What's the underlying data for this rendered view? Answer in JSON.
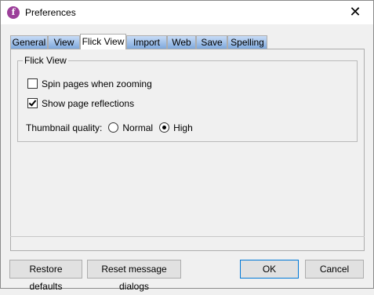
{
  "window": {
    "title": "Preferences",
    "close_glyph": "✕",
    "app_icon_glyph": "f"
  },
  "tabs": [
    {
      "label": "General",
      "active": false
    },
    {
      "label": "View",
      "active": false
    },
    {
      "label": "Flick View",
      "active": true
    },
    {
      "label": "Import",
      "active": false
    },
    {
      "label": "Web",
      "active": false
    },
    {
      "label": "Save",
      "active": false
    },
    {
      "label": "Spelling",
      "active": false
    }
  ],
  "flick_view": {
    "group_label": "Flick View",
    "spin_pages": {
      "label": "Spin pages when zooming",
      "checked": false
    },
    "show_reflections": {
      "label": "Show page reflections",
      "checked": true
    },
    "thumbnail_quality": {
      "label": "Thumbnail quality:",
      "options": [
        {
          "label": "Normal",
          "selected": false
        },
        {
          "label": "High",
          "selected": true
        }
      ]
    }
  },
  "buttons": {
    "restore_defaults": "Restore defaults",
    "reset_dialogs": "Reset message dialogs",
    "ok": "OK",
    "cancel": "Cancel"
  },
  "icons": {
    "app": "app-logo-icon",
    "close": "close-icon",
    "check": "checkmark-icon",
    "radio": "radio-dot-icon"
  },
  "colors": {
    "tab_inactive_top": "#c8dcf7",
    "tab_inactive_bottom": "#7ea8dc",
    "app_icon": "#9c3f9a",
    "default_button_border": "#0078d7"
  }
}
